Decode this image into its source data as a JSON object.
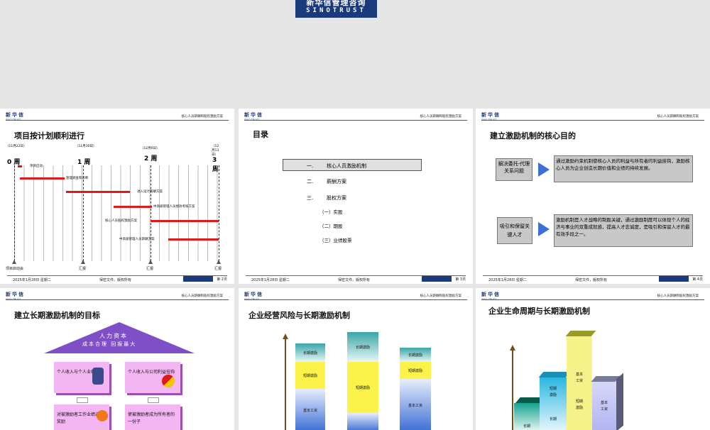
{
  "logo": {
    "line1": "新华信管理咨询",
    "line2": "SINOTRUST"
  },
  "header": {
    "logo_cn": "新华信",
    "logo_en": "SINO TRUST",
    "title": "核心人员薪酬和股权激励方案"
  },
  "footer": {
    "date": "2025年1月28日 星期二",
    "confidential": "保密文件，版权所有"
  },
  "slide1": {
    "title": "项目按计划顺利进行",
    "page": "第 2页",
    "dates": [
      "（11月22日）",
      "（11月30日）",
      "（12月6日）",
      "（12月13日）"
    ],
    "weeks": [
      "0 周",
      "1 周",
      "2 周",
      "3 周"
    ],
    "tasks": [
      "项目启动",
      "管理调查和诊断",
      "进入设计薪酬方案",
      "中高级管理人员绩效考核方案",
      "核心人员股权激励方案",
      "中高级管理人员薪酬方案"
    ],
    "milestones": [
      "项目启动会",
      "汇报",
      "汇报",
      "汇报"
    ]
  },
  "slide2": {
    "title": "目录",
    "page": "第 3页",
    "items": [
      {
        "num": "一.",
        "label": "核心人员激励机制"
      },
      {
        "num": "二.",
        "label": "薪酬方案"
      },
      {
        "num": "三.",
        "label": "股权方案"
      }
    ],
    "subitems": [
      "（一）实股",
      "（二）期股",
      "（三）业绩股票"
    ]
  },
  "slide3": {
    "title": "建立激励机制的核心目的",
    "page": "第 4页",
    "rows": [
      {
        "label": "解决委托-代理关系问题",
        "text": "通过激励约束机制使核心人员的利益与所有者的利益挂钩，激励核心人员为企业创造长期价值和业绩的持续发展。"
      },
      {
        "label": "吸引和保留关键人才",
        "text": "激励机制是人才战略的制胜关键，通过激励制度可以体现个人的经济与事业的双重成就感，提高人才忠诚度，是吸引和保留人才的最有效手段之一。"
      }
    ]
  },
  "slide4": {
    "title": "建立长期激励机制的目标",
    "roof": [
      "人力资本",
      "成本合理 回报最大"
    ],
    "boxes": [
      "个人收入与个人业绩挂钩",
      "个人收入与公司利益挂钩",
      "对被激励者工作业绩进行奖励",
      "使被激励者成为所有者的一份子"
    ]
  },
  "slide5": {
    "title": "企业经营风险与长期激励机制",
    "col1": [
      "长期激励",
      "短期激励",
      "基本工资"
    ],
    "col2": [
      "长期激励",
      "短期激励"
    ],
    "col3": [
      "长期激励",
      "短期激励",
      "基本工资"
    ]
  },
  "slide6": {
    "title": "企业生命周期与长期激励机制",
    "b1": "长期",
    "b2a": "短期激励",
    "b2b": "长期",
    "b3a": "基本工资",
    "b3b": "短期激励",
    "b4": "基本工资"
  },
  "colors": {
    "navy": "#1b3a7c",
    "red": "#e01919",
    "purple": "#7f4fc8",
    "pink": "#f3b6f2",
    "arrow": "#3d6fd6"
  }
}
